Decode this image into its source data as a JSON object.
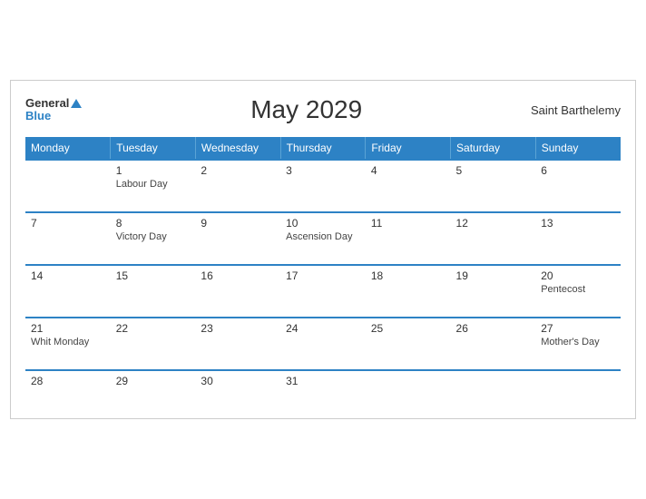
{
  "header": {
    "logo_general": "General",
    "logo_blue": "Blue",
    "title": "May 2029",
    "region": "Saint Barthelemy"
  },
  "days_of_week": [
    "Monday",
    "Tuesday",
    "Wednesday",
    "Thursday",
    "Friday",
    "Saturday",
    "Sunday"
  ],
  "weeks": [
    [
      {
        "num": "",
        "holiday": ""
      },
      {
        "num": "1",
        "holiday": "Labour Day"
      },
      {
        "num": "2",
        "holiday": ""
      },
      {
        "num": "3",
        "holiday": ""
      },
      {
        "num": "4",
        "holiday": ""
      },
      {
        "num": "5",
        "holiday": ""
      },
      {
        "num": "6",
        "holiday": ""
      }
    ],
    [
      {
        "num": "7",
        "holiday": ""
      },
      {
        "num": "8",
        "holiday": "Victory Day"
      },
      {
        "num": "9",
        "holiday": ""
      },
      {
        "num": "10",
        "holiday": "Ascension Day"
      },
      {
        "num": "11",
        "holiday": ""
      },
      {
        "num": "12",
        "holiday": ""
      },
      {
        "num": "13",
        "holiday": ""
      }
    ],
    [
      {
        "num": "14",
        "holiday": ""
      },
      {
        "num": "15",
        "holiday": ""
      },
      {
        "num": "16",
        "holiday": ""
      },
      {
        "num": "17",
        "holiday": ""
      },
      {
        "num": "18",
        "holiday": ""
      },
      {
        "num": "19",
        "holiday": ""
      },
      {
        "num": "20",
        "holiday": "Pentecost"
      }
    ],
    [
      {
        "num": "21",
        "holiday": "Whit Monday"
      },
      {
        "num": "22",
        "holiday": ""
      },
      {
        "num": "23",
        "holiday": ""
      },
      {
        "num": "24",
        "holiday": ""
      },
      {
        "num": "25",
        "holiday": ""
      },
      {
        "num": "26",
        "holiday": ""
      },
      {
        "num": "27",
        "holiday": "Mother's Day"
      }
    ],
    [
      {
        "num": "28",
        "holiday": ""
      },
      {
        "num": "29",
        "holiday": ""
      },
      {
        "num": "30",
        "holiday": ""
      },
      {
        "num": "31",
        "holiday": ""
      },
      {
        "num": "",
        "holiday": ""
      },
      {
        "num": "",
        "holiday": ""
      },
      {
        "num": "",
        "holiday": ""
      }
    ]
  ]
}
